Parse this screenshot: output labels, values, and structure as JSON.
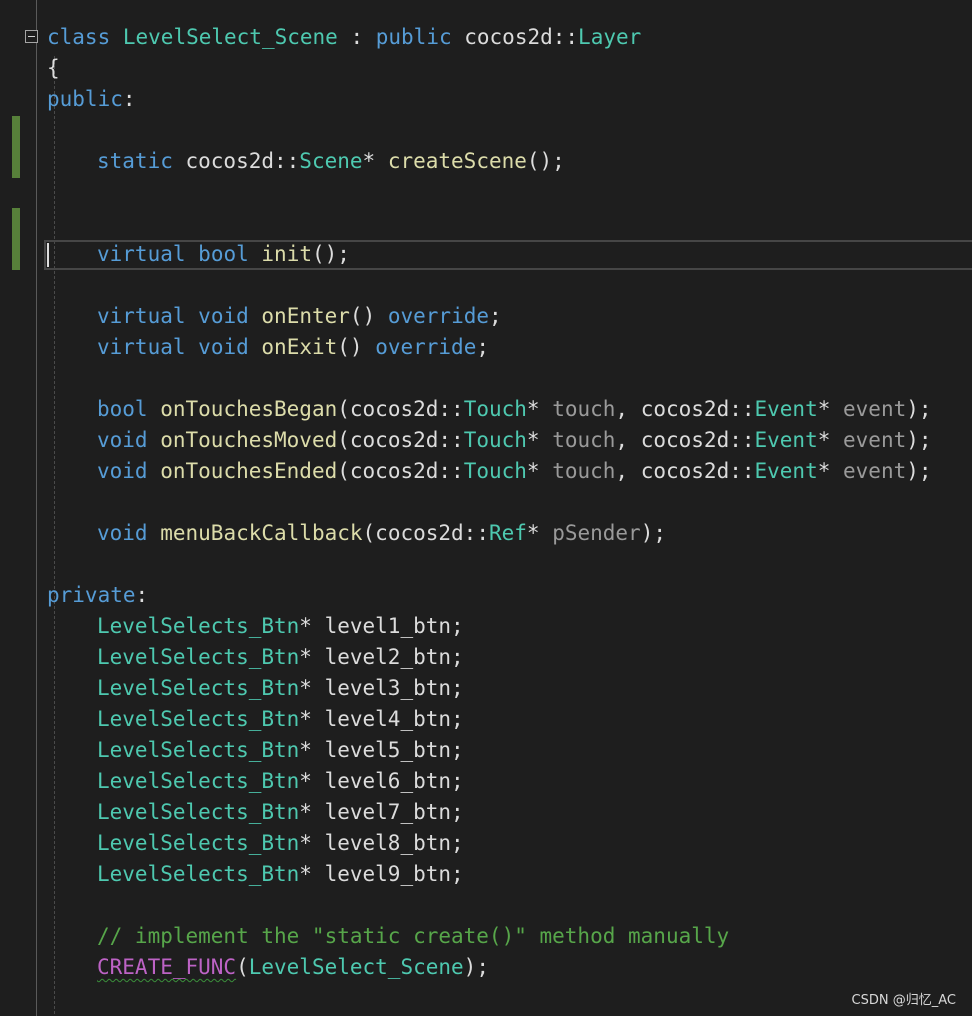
{
  "editor": {
    "lines": [
      [
        [
          "kw",
          "class"
        ],
        [
          "pl",
          " "
        ],
        [
          "ty",
          "LevelSelect_Scene"
        ],
        [
          "pl",
          " : "
        ],
        [
          "kw",
          "public"
        ],
        [
          "pl",
          " cocos2d::"
        ],
        [
          "ty",
          "Layer"
        ]
      ],
      [
        [
          "pl",
          "{"
        ]
      ],
      [
        [
          "kw",
          "public"
        ],
        [
          "pl",
          ":"
        ]
      ],
      [],
      [
        [
          "kw",
          "static"
        ],
        [
          "pl",
          " cocos2d::"
        ],
        [
          "ty",
          "Scene"
        ],
        [
          "pl",
          "* "
        ],
        [
          "fn",
          "createScene"
        ],
        [
          "pl",
          "();"
        ]
      ],
      [],
      [],
      [
        [
          "kw",
          "virtual"
        ],
        [
          "pl",
          " "
        ],
        [
          "kw",
          "bool"
        ],
        [
          "pl",
          " "
        ],
        [
          "fn",
          "init"
        ],
        [
          "pl",
          "();"
        ]
      ],
      [],
      [
        [
          "kw",
          "virtual"
        ],
        [
          "pl",
          " "
        ],
        [
          "kw",
          "void"
        ],
        [
          "pl",
          " "
        ],
        [
          "fn",
          "onEnter"
        ],
        [
          "pl",
          "() "
        ],
        [
          "kw",
          "override"
        ],
        [
          "pl",
          ";"
        ]
      ],
      [
        [
          "kw",
          "virtual"
        ],
        [
          "pl",
          " "
        ],
        [
          "kw",
          "void"
        ],
        [
          "pl",
          " "
        ],
        [
          "fn",
          "onExit"
        ],
        [
          "pl",
          "() "
        ],
        [
          "kw",
          "override"
        ],
        [
          "pl",
          ";"
        ]
      ],
      [],
      [
        [
          "kw",
          "bool"
        ],
        [
          "pl",
          " "
        ],
        [
          "fn",
          "onTouchesBegan"
        ],
        [
          "pl",
          "(cocos2d::"
        ],
        [
          "ty",
          "Touch"
        ],
        [
          "pl",
          "* "
        ],
        [
          "pr",
          "touch"
        ],
        [
          "pl",
          ", cocos2d::"
        ],
        [
          "ty",
          "Event"
        ],
        [
          "pl",
          "* "
        ],
        [
          "pr",
          "event"
        ],
        [
          "pl",
          ");"
        ]
      ],
      [
        [
          "kw",
          "void"
        ],
        [
          "pl",
          " "
        ],
        [
          "fn",
          "onTouchesMoved"
        ],
        [
          "pl",
          "(cocos2d::"
        ],
        [
          "ty",
          "Touch"
        ],
        [
          "pl",
          "* "
        ],
        [
          "pr",
          "touch"
        ],
        [
          "pl",
          ", cocos2d::"
        ],
        [
          "ty",
          "Event"
        ],
        [
          "pl",
          "* "
        ],
        [
          "pr",
          "event"
        ],
        [
          "pl",
          ");"
        ]
      ],
      [
        [
          "kw",
          "void"
        ],
        [
          "pl",
          " "
        ],
        [
          "fn",
          "onTouchesEnded"
        ],
        [
          "pl",
          "(cocos2d::"
        ],
        [
          "ty",
          "Touch"
        ],
        [
          "pl",
          "* "
        ],
        [
          "pr",
          "touch"
        ],
        [
          "pl",
          ", cocos2d::"
        ],
        [
          "ty",
          "Event"
        ],
        [
          "pl",
          "* "
        ],
        [
          "pr",
          "event"
        ],
        [
          "pl",
          ");"
        ]
      ],
      [],
      [
        [
          "kw",
          "void"
        ],
        [
          "pl",
          " "
        ],
        [
          "fn",
          "menuBackCallback"
        ],
        [
          "pl",
          "(cocos2d::"
        ],
        [
          "ty",
          "Ref"
        ],
        [
          "pl",
          "* "
        ],
        [
          "pr",
          "pSender"
        ],
        [
          "pl",
          ");"
        ]
      ],
      [],
      [
        [
          "kw",
          "private"
        ],
        [
          "pl",
          ":"
        ]
      ],
      [
        [
          "ty",
          "LevelSelects_Btn"
        ],
        [
          "pl",
          "* level1_btn;"
        ]
      ],
      [
        [
          "ty",
          "LevelSelects_Btn"
        ],
        [
          "pl",
          "* level2_btn;"
        ]
      ],
      [
        [
          "ty",
          "LevelSelects_Btn"
        ],
        [
          "pl",
          "* level3_btn;"
        ]
      ],
      [
        [
          "ty",
          "LevelSelects_Btn"
        ],
        [
          "pl",
          "* level4_btn;"
        ]
      ],
      [
        [
          "ty",
          "LevelSelects_Btn"
        ],
        [
          "pl",
          "* level5_btn;"
        ]
      ],
      [
        [
          "ty",
          "LevelSelects_Btn"
        ],
        [
          "pl",
          "* level6_btn;"
        ]
      ],
      [
        [
          "ty",
          "LevelSelects_Btn"
        ],
        [
          "pl",
          "* level7_btn;"
        ]
      ],
      [
        [
          "ty",
          "LevelSelects_Btn"
        ],
        [
          "pl",
          "* level8_btn;"
        ]
      ],
      [
        [
          "ty",
          "LevelSelects_Btn"
        ],
        [
          "pl",
          "* level9_btn;"
        ]
      ],
      [],
      [
        [
          "cm",
          "// implement the \"static create()\" method manually"
        ]
      ],
      [
        [
          "mc",
          "CREATE_FUNC"
        ],
        [
          "pl",
          "("
        ],
        [
          "ty",
          "LevelSelect_Scene"
        ],
        [
          "pl",
          ");"
        ]
      ]
    ]
  },
  "watermark": "CSDN @归忆_AC",
  "colors": {
    "background": "#1e1e1e",
    "keyword": "#569cd6",
    "type": "#4ec9b0",
    "function": "#dcdcaa",
    "parameter": "#9a9a9a",
    "plain": "#dcdcdc",
    "comment": "#57a64a",
    "macro": "#bd63c5",
    "change_marker": "#57803a"
  }
}
